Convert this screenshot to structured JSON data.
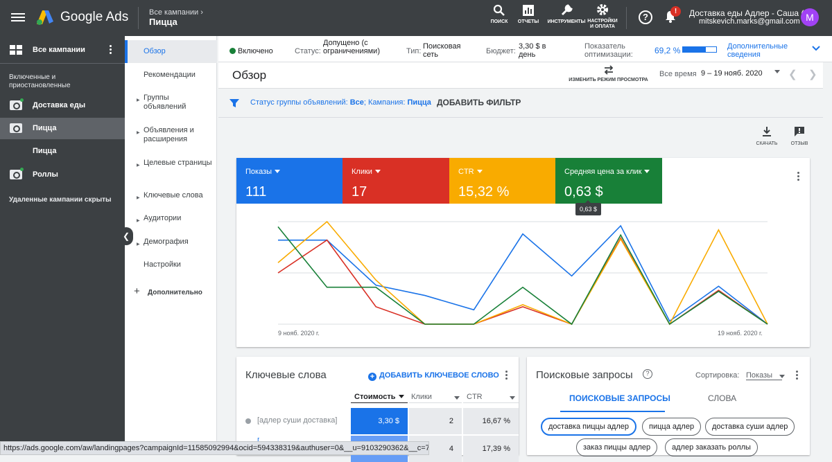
{
  "app": {
    "brand": "Google Ads",
    "breadcrumb_parent": "Все кампании",
    "breadcrumb_current": "Пицца",
    "tools": [
      "ПОИСК",
      "ОТЧЕТЫ",
      "ИНСТРУМЕНТЫ",
      "НАСТРОЙКИ И ОПЛАТА"
    ],
    "notification_badge": "!",
    "account_name": "Доставка еды Адлер - Саша (4…",
    "account_email": "mitskevich.marks@gmail.com",
    "avatar_letter": "M"
  },
  "left_nav": {
    "all_campaigns": "Все кампании",
    "section_label": "Включенные и приостановленные",
    "campaigns": [
      {
        "label": "Доставка еды",
        "active": false
      },
      {
        "label": "Пицца",
        "active": true
      },
      {
        "label": "Пицца",
        "sub": true
      },
      {
        "label": "Роллы",
        "active": false
      }
    ],
    "hidden_note": "Удаленные кампании скрыты"
  },
  "sub_nav": {
    "items": [
      "Обзор",
      "Рекомендации",
      "Группы объявлений",
      "Объявления и расширения",
      "Целевые страницы",
      "Ключевые слова",
      "Аудитории",
      "Демография",
      "Настройки"
    ],
    "more": "Дополнительно"
  },
  "status_bar": {
    "state": "Включено",
    "status_label": "Статус:",
    "status_value": "Допущено (с ограничениями)",
    "type_label": "Тип:",
    "type_value": "Поисковая сеть",
    "budget_label": "Бюджет:",
    "budget_value": "3,30 $ в день",
    "opt_label": "Показатель оптимизации:",
    "opt_value": "69,2 %",
    "opt_fraction": 0.692,
    "more_link": "Дополнительные сведения"
  },
  "main": {
    "title": "Обзор",
    "view_mode": "ИЗМЕНИТЬ РЕЖИМ ПРОСМОТРА",
    "date_label": "Все время",
    "date_range": "9 – 19 нояб. 2020",
    "filter_prefix": "Статус группы объявлений:",
    "filter_value1": "Все",
    "filter_mid": "; Кампания:",
    "filter_value2": "Пицца",
    "add_filter": "ДОБАВИТЬ ФИЛЬТР",
    "download": "СКАЧАТЬ",
    "feedback": "ОТЗЫВ"
  },
  "metrics": [
    {
      "label": "Показы",
      "value": "111",
      "color": "#1a73e8"
    },
    {
      "label": "Клики",
      "value": "17",
      "color": "#d93025"
    },
    {
      "label": "CTR",
      "value": "15,32 %",
      "color": "#f9ab00"
    },
    {
      "label": "Средняя цена за клик",
      "value": "0,63 $",
      "color": "#188038"
    }
  ],
  "tooltip": "0,63 $",
  "chart_data": {
    "type": "line",
    "x": [
      "9 нояб. 2020 г.",
      "10 нояб.",
      "11 нояб.",
      "12 нояб.",
      "13 нояб.",
      "14 нояб.",
      "15 нояб.",
      "16 нояб.",
      "17 нояб.",
      "18 нояб.",
      "19 нояб. 2020 г."
    ],
    "x_tick_labels": [
      "9 нояб. 2020 г.",
      "19 нояб. 2020 г."
    ],
    "ylim": [
      0,
      1
    ],
    "grid": true,
    "series": [
      {
        "name": "Показы",
        "color": "#1a73e8",
        "values": [
          0.82,
          0.82,
          0.38,
          0.28,
          0.14,
          0.88,
          0.47,
          0.96,
          0.03,
          0.37,
          0.0
        ]
      },
      {
        "name": "Клики",
        "color": "#d93025",
        "values": [
          0.5,
          0.82,
          0.17,
          0.0,
          0.0,
          0.17,
          0.0,
          0.84,
          0.0,
          0.33,
          0.0
        ]
      },
      {
        "name": "CTR",
        "color": "#f9ab00",
        "values": [
          0.6,
          1.0,
          0.43,
          0.0,
          0.0,
          0.19,
          0.0,
          0.83,
          0.0,
          0.92,
          0.0
        ]
      },
      {
        "name": "Средняя цена за клик",
        "color": "#188038",
        "values": [
          0.95,
          0.36,
          0.36,
          0.0,
          0.0,
          0.36,
          0.0,
          0.87,
          0.0,
          0.32,
          0.0
        ]
      }
    ]
  },
  "keywords": {
    "title": "Ключевые слова",
    "add": "ДОБАВИТЬ КЛЮЧЕВОЕ СЛОВО",
    "columns": [
      "Стоимость",
      "Клики",
      "CTR"
    ],
    "rows": [
      {
        "keyword": "[адлер суши доставка]",
        "cost": "3,30 $",
        "clicks": "2",
        "ctr": "16,67 %"
      },
      {
        "keyword": "[",
        "cost": "",
        "clicks": "4",
        "ctr": "17,39 %"
      }
    ]
  },
  "search_queries": {
    "title": "Поисковые запросы",
    "sort_label": "Сортировка:",
    "sort_value": "Показы",
    "tabs": [
      "ПОИСКОВЫЕ ЗАПРОСЫ",
      "СЛОВА"
    ],
    "chips": [
      "доставка пиццы адлер",
      "пицца адлер",
      "доставка суши адлер",
      "заказ пиццы адлер",
      "адлер заказать роллы"
    ]
  },
  "status_url": "https://ads.google.com/aw/landingpages?campaignId=11585092994&ocid=594338319&authuser=0&__u=9103290362&__c=7058527831"
}
